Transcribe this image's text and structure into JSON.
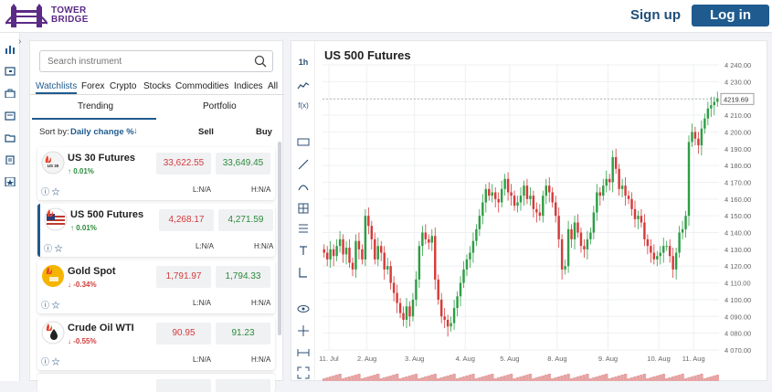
{
  "brand": {
    "name_line1": "TOWER",
    "name_line2": "BRIDGE"
  },
  "header": {
    "signup": "Sign up",
    "login": "Log in"
  },
  "search": {
    "placeholder": "Search instrument"
  },
  "tabs": [
    "Watchlists",
    "Forex",
    "Crypto",
    "Stocks",
    "Commodities",
    "Indices",
    "All"
  ],
  "subtabs": [
    "Trending",
    "Portfolio"
  ],
  "sort": {
    "label": "Sort by:",
    "value": "Daily change %",
    "sell": "Sell",
    "buy": "Buy"
  },
  "instruments": [
    {
      "name": "US 30 Futures",
      "change": "0.01%",
      "direction": "up",
      "sell": "33,622.55",
      "buy": "33,649.45",
      "low": "L:N/A",
      "high": "H:N/A",
      "icon_text": "US 30 Futures"
    },
    {
      "name": "US 500 Futures",
      "change": "0.01%",
      "direction": "up",
      "sell": "4,268.17",
      "buy": "4,271.59",
      "low": "L:N/A",
      "high": "H:N/A"
    },
    {
      "name": "Gold Spot",
      "change": "-0.34%",
      "direction": "down",
      "sell": "1,791.97",
      "buy": "1,794.33",
      "low": "L:N/A",
      "high": "H:N/A"
    },
    {
      "name": "Crude Oil WTI",
      "change": "-0.55%",
      "direction": "down",
      "sell": "90.95",
      "buy": "91.23",
      "low": "L:N/A",
      "high": "H:N/A"
    }
  ],
  "chart": {
    "title": "US 500 Futures",
    "timeframe": "1h",
    "current_price": "4219.69",
    "colors": {
      "up": "#2e9e45",
      "down": "#d63a3a",
      "accent": "#1f5b8e"
    }
  },
  "chart_data": {
    "type": "candlestick",
    "title": "US 500 Futures",
    "x_tick_labels": [
      "11. Jul",
      "2. Aug",
      "3. Aug",
      "4. Aug",
      "5. Aug",
      "8. Aug",
      "9. Aug",
      "10. Aug",
      "11. Aug"
    ],
    "y_tick_labels": [
      "4 240.00",
      "4 230.00",
      "4 220.00",
      "4 210.00",
      "4 200.00",
      "4 190.00",
      "4 180.00",
      "4 170.00",
      "4 160.00",
      "4 150.00",
      "4 140.00",
      "4 130.00",
      "4 120.00",
      "4 110.00",
      "4 100.00",
      "4 090.00",
      "4 080.00",
      "4 070.00"
    ],
    "ylim": [
      4070,
      4240
    ],
    "last_price": 4219.69,
    "closes": [
      4128,
      4124,
      4130,
      4126,
      4132,
      4136,
      4127,
      4131,
      4122,
      4118,
      4135,
      4130,
      4124,
      4150,
      4144,
      4136,
      4124,
      4132,
      4128,
      4118,
      4120,
      4110,
      4104,
      4098,
      4092,
      4088,
      4096,
      4090,
      4100,
      4112,
      4132,
      4140,
      4136,
      4134,
      4138,
      4112,
      4100,
      4090,
      4088,
      4084,
      4086,
      4095,
      4102,
      4110,
      4118,
      4124,
      4128,
      4135,
      4142,
      4150,
      4158,
      4166,
      4162,
      4164,
      4160,
      4158,
      4166,
      4172,
      4164,
      4162,
      4156,
      4158,
      4162,
      4168,
      4160,
      4162,
      4154,
      4152,
      4150,
      4162,
      4168,
      4164,
      4158,
      4150,
      4136,
      4118,
      4120,
      4142,
      4136,
      4146,
      4140,
      4132,
      4130,
      4136,
      4140,
      4152,
      4164,
      4162,
      4168,
      4172,
      4170,
      4185,
      4178,
      4166,
      4168,
      4162,
      4160,
      4154,
      4148,
      4150,
      4146,
      4136,
      4132,
      4128,
      4124,
      4126,
      4128,
      4132,
      4132,
      4126,
      4118,
      4128,
      4140,
      4142,
      4150,
      4194,
      4200,
      4196,
      4192,
      4202,
      4208,
      4214,
      4216,
      4218,
      4220
    ]
  }
}
